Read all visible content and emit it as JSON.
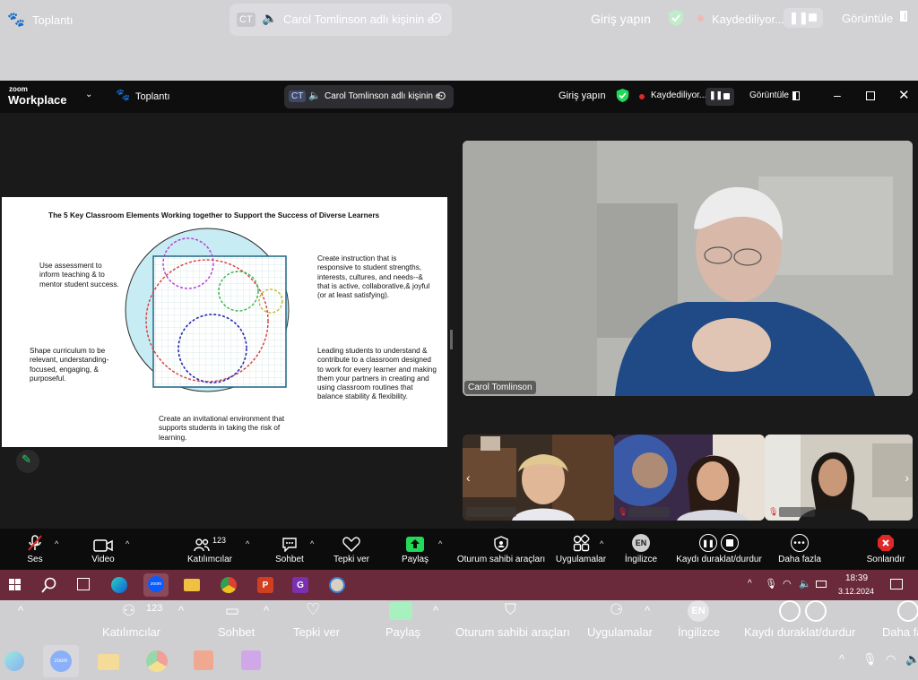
{
  "outer_bar": {
    "app_label": "Toplantı",
    "speaker_initials": "CT",
    "speaker_text": "Carol Tomlinson adlı kişinin e",
    "sign_in": "Giriş yapın",
    "recording": "Kaydediliyor...",
    "view": "Görüntüle"
  },
  "window": {
    "logo_top": "zoom",
    "logo_bottom": "Workplace",
    "meeting_label": "Toplantı",
    "speaker_initials": "CT",
    "speaker_text": "Carol Tomlinson adlı kişinin e",
    "sign_in": "Giriş yapın",
    "recording": "Kaydediliyor...",
    "view": "Görüntüle"
  },
  "slide": {
    "title": "The 5 Key Classroom Elements Working together to Support the Success of Diverse Learners",
    "text_assessment": "Use assessment to inform teaching & to mentor student success.",
    "text_curriculum": "Shape curriculum to be relevant, understanding-focused, engaging, & purposeful.",
    "text_instruction": "Create instruction that is responsive to student strengths, interests, cultures, and needs--& that is active, collaborative,& joyful (or at least satisfying).",
    "text_leading": "Leading students to understand & contribute to a classroom designed to work for every learner and making them your partners in creating and using classroom routines that balance stability & flexibility.",
    "text_environment": "Create an invitational environment that supports students in taking the risk of learning."
  },
  "main_video": {
    "name": "Carol Tomlinson"
  },
  "controls": {
    "audio": "Ses",
    "video": "Video",
    "participants": "Katılımcılar",
    "participants_count": "123",
    "chat": "Sohbet",
    "react": "Tepki ver",
    "share": "Paylaş",
    "host_tools": "Oturum sahibi araçları",
    "apps": "Uygulamalar",
    "language": "İngilizce",
    "language_badge": "EN",
    "pause_stop": "Kaydı duraklat/durdur",
    "more": "Daha fazla",
    "end": "Sonlandır"
  },
  "taskbar": {
    "time": "18:39",
    "date": "3.12.2024"
  },
  "ghost_bottom": {
    "participants": "Katılımcılar",
    "participants_count": "123",
    "chat": "Sohbet",
    "react": "Tepki ver",
    "share": "Paylaş",
    "host_tools": "Oturum sahibi araçları",
    "apps": "Uygulamalar",
    "language": "İngilizce",
    "language_badge": "EN",
    "pause_stop": "Kaydı duraklat/durdur",
    "more": "Daha fa"
  },
  "colors": {
    "zoom_blue": "#0b5cff",
    "green": "#23d959",
    "end_red": "#e02828",
    "taskbar": "#6a2a3c"
  }
}
